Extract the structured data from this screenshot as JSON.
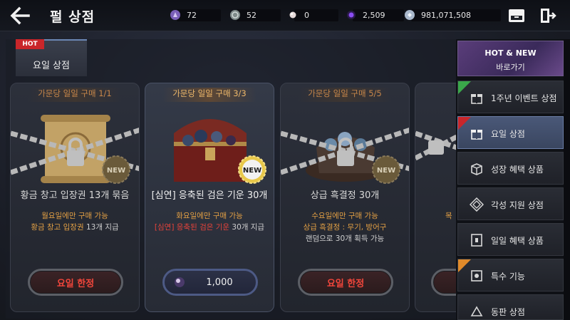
{
  "header": {
    "title": "펄 상점",
    "currencies": [
      {
        "icon": "purple-crystal-icon",
        "value": "72",
        "color": "#8a6cc8"
      },
      {
        "icon": "silver-coin-icon",
        "value": "52",
        "color": "#9aa7a4"
      },
      {
        "icon": "pearl-icon",
        "value": "0",
        "color": "#d8c9c9"
      },
      {
        "icon": "dark-energy-icon",
        "value": "2,509",
        "color": "#6a3cc8"
      },
      {
        "icon": "silver-icon",
        "value": "981,071,508",
        "color": "#b8c7dc"
      }
    ]
  },
  "tab": {
    "label": "요일 상점",
    "tag": "HOT"
  },
  "cards": [
    {
      "limit": "가문당 일일 구매 1/1",
      "name": "황금 창고 입장권 13개 묶음",
      "desc1": "월요일에만 구매 가능",
      "desc2_prefix": "황금 창고 입장권",
      "desc2_suffix": " 13개 지급",
      "desc3": "",
      "button": "요일 한정",
      "new": "NEW",
      "locked": true
    },
    {
      "limit": "가문당 일일 구매 3/3",
      "name": "[심연] 응축된 검은 기운 30개",
      "desc1": "화요일에만 구매 가능",
      "desc2_prefix": "[심연] 응축된 검은 기운",
      "desc2_suffix": " 30개 지급",
      "desc3": "",
      "button": "1,000",
      "new": "NEW",
      "locked": false
    },
    {
      "limit": "가문당 일일 구매 5/5",
      "name": "상급 흑결정 30개",
      "desc1": "수요일에만 구매 가능",
      "desc2_prefix": "상급 흑결정 : 무기, 방어구",
      "desc2_suffix": "",
      "desc3": "랜덤으로 30개 획득 가능",
      "button": "요일 한정",
      "new": "NEW",
      "locked": true
    },
    {
      "desc1": "목"
    }
  ],
  "sidebar": {
    "hotnew": {
      "title": "HOT & NEW",
      "subtitle": "바로가기"
    },
    "items": [
      {
        "label": "1주년 이벤트 상점",
        "icon": "gift-icon",
        "tag": "green"
      },
      {
        "label": "요일 상점",
        "icon": "gift-icon",
        "tag": "red",
        "active": true
      },
      {
        "label": "성장 혜택 상품",
        "icon": "box-icon"
      },
      {
        "label": "각성 지원 상점",
        "icon": "emblem-icon"
      },
      {
        "label": "일일 혜택 상품",
        "icon": "calendar-icon"
      },
      {
        "label": "특수 기능",
        "icon": "scroll-icon",
        "tag": "orange"
      },
      {
        "label": "동판 상점",
        "icon": "plate-icon"
      }
    ]
  },
  "colors": {
    "limit_text": "#c8874a",
    "limit_text_active": "#f0b96a",
    "desc_orange": "#e3a044",
    "desc_red": "#e8433a",
    "limited_red": "#f2463b"
  }
}
